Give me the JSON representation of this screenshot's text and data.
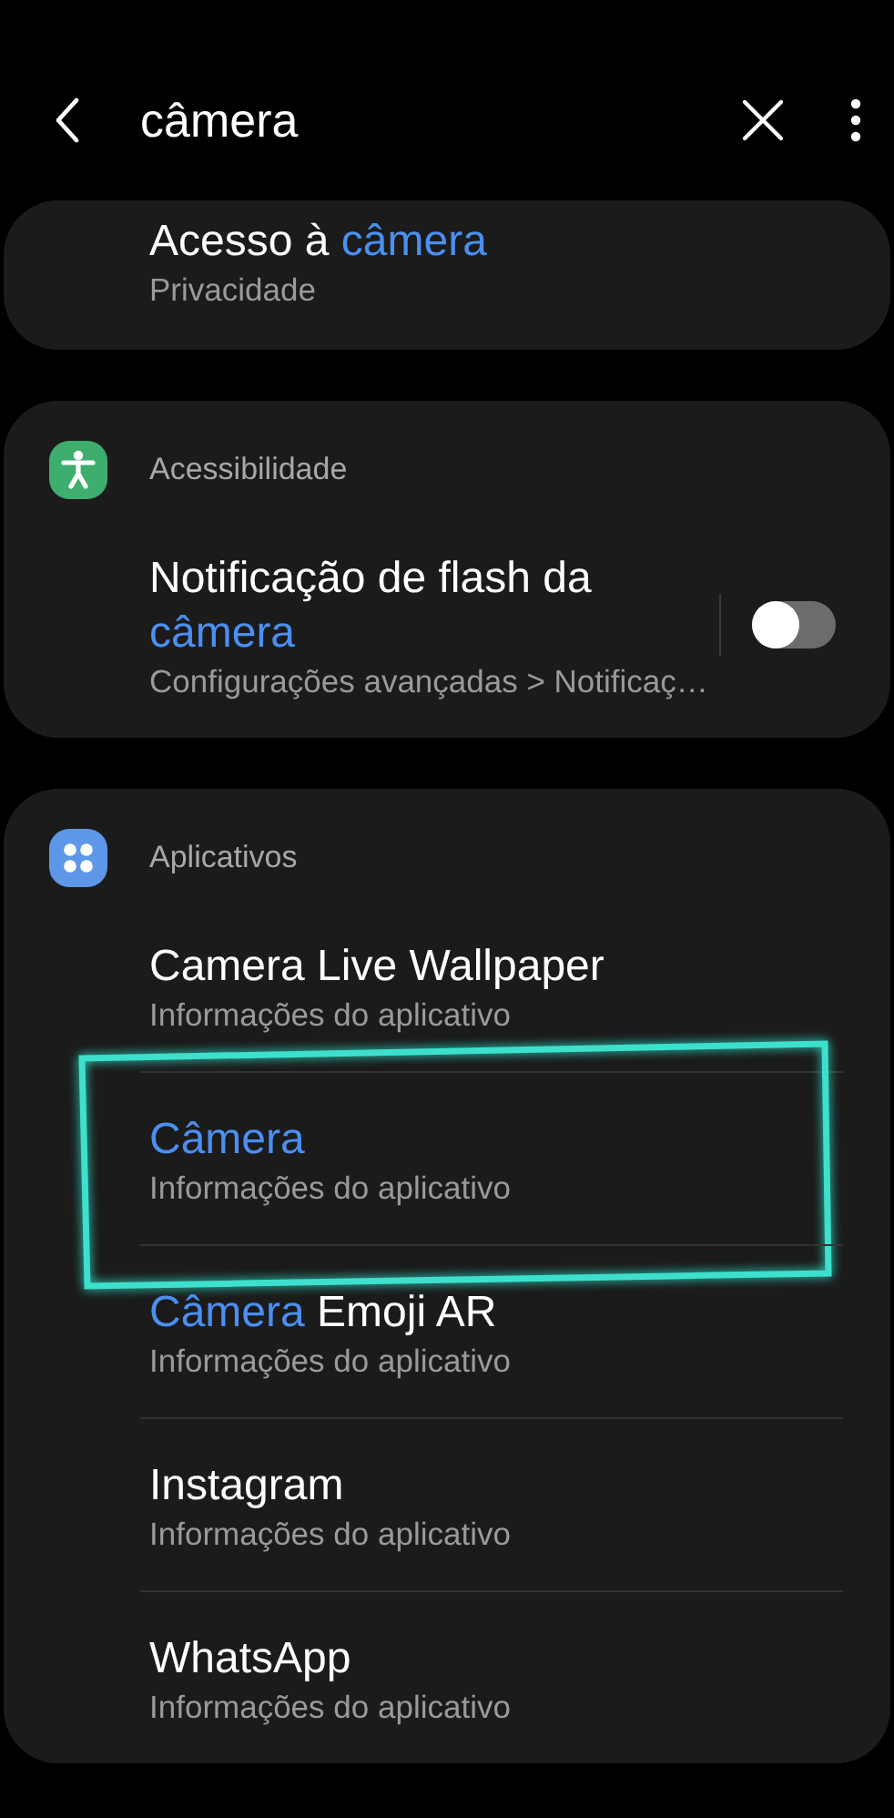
{
  "header": {
    "query": "câmera"
  },
  "sections": [
    {
      "items": [
        {
          "title": [
            {
              "text": "Acesso à ",
              "match": false
            },
            {
              "text": "câmera",
              "match": true
            }
          ],
          "subtitle": "Privacidade"
        }
      ]
    },
    {
      "category": {
        "kind": "accessibility",
        "label": "Acessibilidade"
      },
      "items": [
        {
          "title": [
            {
              "text": "Notificação de flash da ",
              "match": false
            },
            {
              "text": "câmera",
              "match": true
            }
          ],
          "subtitle": "Configurações avançadas > Notificaç…",
          "toggle": {
            "on": false
          }
        }
      ]
    },
    {
      "category": {
        "kind": "apps",
        "label": "Aplicativos"
      },
      "items": [
        {
          "title": [
            {
              "text": "Camera Live Wallpaper",
              "match": false
            }
          ],
          "subtitle": "Informações do aplicativo"
        },
        {
          "title": [
            {
              "text": "Câmera",
              "match": true
            }
          ],
          "subtitle": "Informações do aplicativo",
          "annotated": true
        },
        {
          "title": [
            {
              "text": "Câmera",
              "match": true
            },
            {
              "text": " Emoji AR",
              "match": false
            }
          ],
          "subtitle": "Informações do aplicativo"
        },
        {
          "title": [
            {
              "text": "Instagram",
              "match": false
            }
          ],
          "subtitle": "Informações do aplicativo"
        },
        {
          "title": [
            {
              "text": "WhatsApp",
              "match": false
            }
          ],
          "subtitle": "Informações do aplicativo"
        }
      ]
    }
  ]
}
